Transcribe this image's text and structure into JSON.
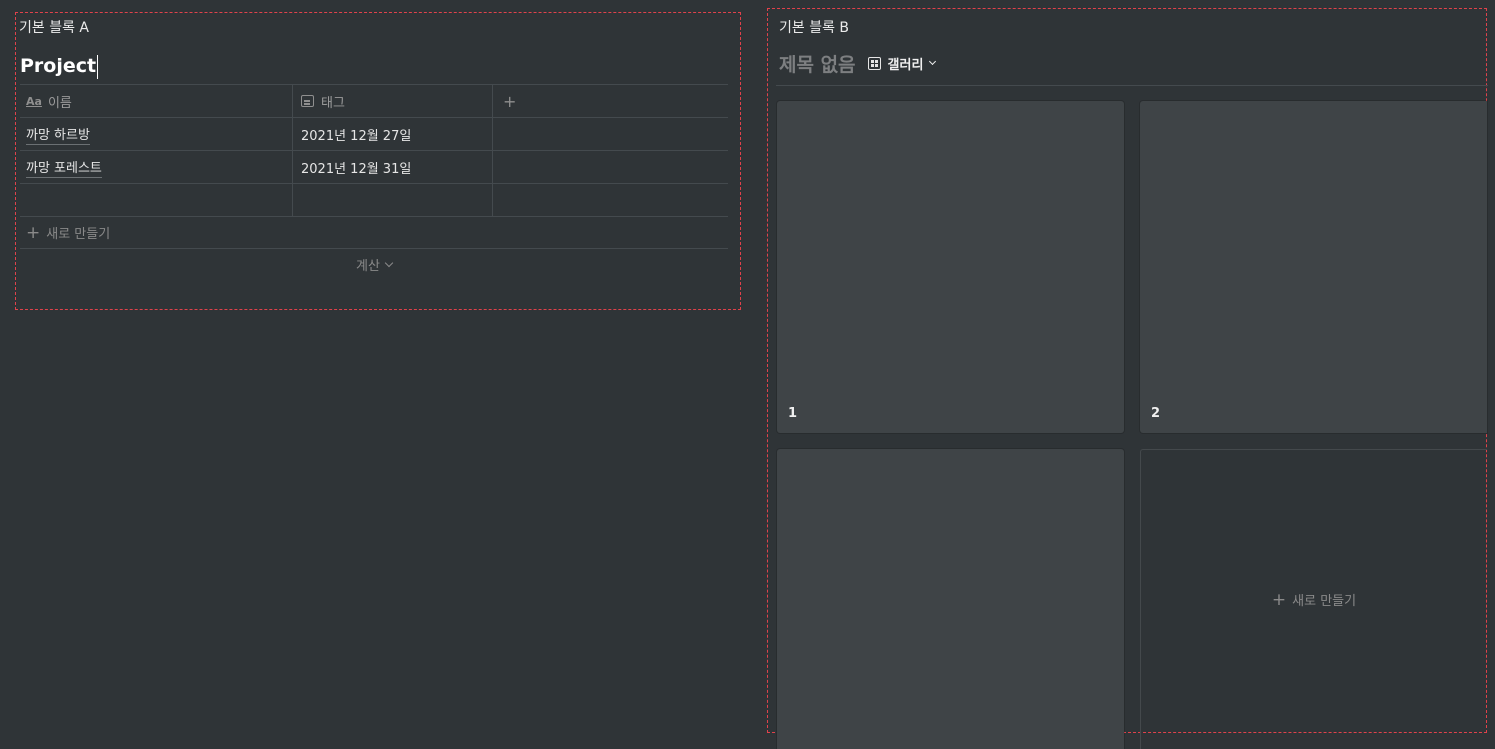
{
  "block_a": {
    "label": "기본 블록 A",
    "title": "Project",
    "columns": [
      {
        "icon": "text-property-icon",
        "icon_glyph": "Aa",
        "label": "이름"
      },
      {
        "icon": "calendar-icon",
        "label": "태그"
      },
      {
        "icon": "plus-icon",
        "label": "+"
      }
    ],
    "rows": [
      {
        "name": "까망 하르방",
        "tag": "2021년 12월 27일"
      },
      {
        "name": "까망 포레스트",
        "tag": "2021년 12월 31일"
      },
      {
        "name": "",
        "tag": ""
      }
    ],
    "new_label": "새로 만들기",
    "new_plus": "+",
    "calc_label": "계산"
  },
  "block_b": {
    "label": "기본 블록 B",
    "title": "제목 없음",
    "view_label": "갤러리",
    "cards": [
      {
        "title": "1"
      },
      {
        "title": "2"
      },
      {
        "title": ""
      }
    ],
    "new_label": "새로 만들기",
    "new_plus": "+"
  },
  "colors": {
    "background": "#2f3437",
    "card": "#3f4447",
    "selection_border": "#e0424b"
  }
}
